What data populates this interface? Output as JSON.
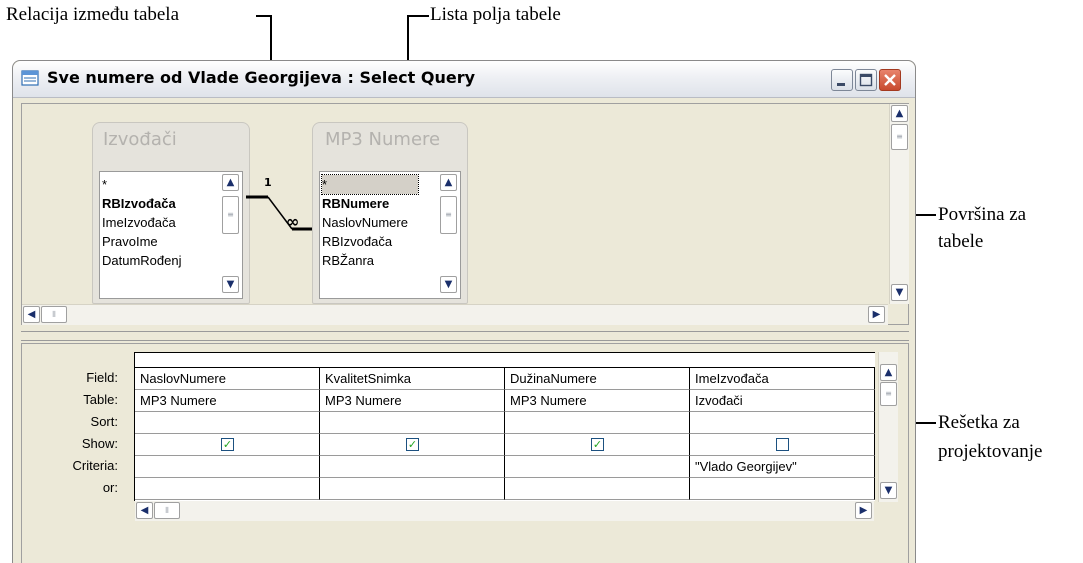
{
  "callouts": {
    "relation": "Relacija između tabela",
    "field_list": "Lista polja tabele",
    "table_area": [
      "Površina za",
      "tabele"
    ],
    "design_grid": [
      "Rešetka za",
      "projektovanje"
    ]
  },
  "window": {
    "title": "Sve numere od Vlade Georgijeva : Select Query",
    "minimize_icon": "minimize-icon",
    "maximize_icon": "maximize-icon",
    "close_icon": "close-icon"
  },
  "tables": [
    {
      "name": "Izvođači",
      "fields": [
        "*",
        "RBIzvođača",
        "ImeIzvođača",
        "PravoIme",
        "DatumRođenj"
      ],
      "key_field": 1
    },
    {
      "name": "MP3 Numere",
      "fields": [
        "*",
        "RBNumere",
        "NaslovNumere",
        "RBIzvođača",
        "RBŽanra"
      ],
      "key_field": 1
    }
  ],
  "relation": {
    "one_label": "1",
    "many_label": "∞"
  },
  "grid": {
    "row_labels": [
      "Field:",
      "Table:",
      "Sort:",
      "Show:",
      "Criteria:",
      "or:"
    ],
    "columns": [
      {
        "field": "NaslovNumere",
        "table": "MP3 Numere",
        "sort": "",
        "show": true,
        "criteria": "",
        "or": ""
      },
      {
        "field": "KvalitetSnimka",
        "table": "MP3 Numere",
        "sort": "",
        "show": true,
        "criteria": "",
        "or": ""
      },
      {
        "field": "DužinaNumere",
        "table": "MP3 Numere",
        "sort": "",
        "show": true,
        "criteria": "",
        "or": ""
      },
      {
        "field": "ImeIzvođača",
        "table": "Izvođači",
        "sort": "",
        "show": false,
        "criteria": "\"Vlado Georgijev\"",
        "or": ""
      }
    ]
  },
  "colors": {
    "window_bg": "#ece9d8",
    "checkmark": "#22a522",
    "close_button": "#c84b2f"
  }
}
